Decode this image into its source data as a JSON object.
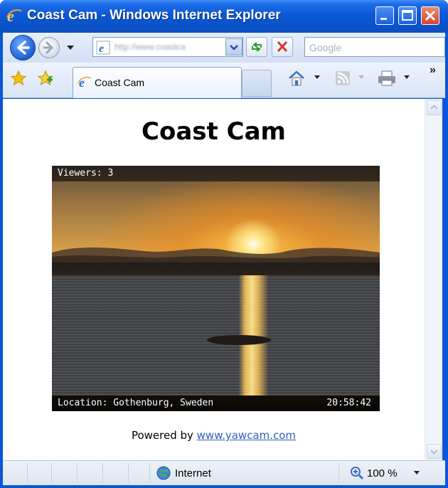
{
  "window": {
    "title": "Coast Cam - Windows Internet Explorer"
  },
  "navbar": {
    "address_text": "http://www.coastca",
    "search_placeholder": "Google"
  },
  "tabbar": {
    "tabs": [
      {
        "label": "Coast Cam"
      }
    ],
    "overflow_label": "»"
  },
  "page": {
    "title": "Coast Cam",
    "webcam": {
      "viewers": "Viewers: 3",
      "location": "Location: Gothenburg, Sweden",
      "time": "20:58:42"
    },
    "powered_by_prefix": "Powered by ",
    "powered_by_link": "www.yawcam.com"
  },
  "statusbar": {
    "zone": "Internet",
    "zoom": "100 %"
  },
  "colors": {
    "titlebar": "#0a56d8",
    "link": "#3060c0",
    "chrome": "#d8e4f6"
  }
}
